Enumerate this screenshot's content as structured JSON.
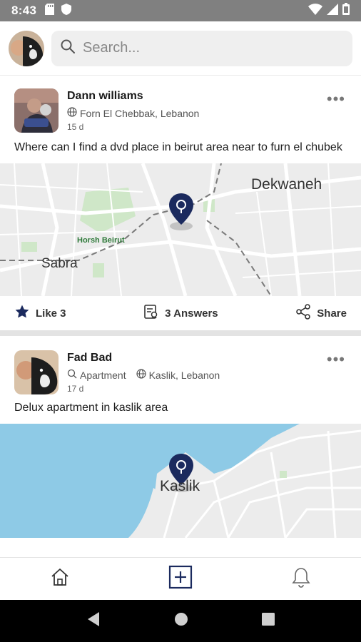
{
  "status_bar": {
    "time": "8:43"
  },
  "search": {
    "placeholder": "Search..."
  },
  "posts": [
    {
      "author": "Dann williams",
      "location": "Forn El Chebbak, Lebanon",
      "age": "15 d",
      "text": "Where can I find a dvd place in beirut area near to furn el chubek",
      "map_labels": {
        "a": "Dekwaneh",
        "b": "Horsh Beirut",
        "c": "Sabra"
      },
      "actions": {
        "like": "Like 3",
        "answers": "3 Answers",
        "share": "Share"
      }
    },
    {
      "author": "Fad Bad",
      "category": "Apartment",
      "location": "Kaslik, Lebanon",
      "age": "17 d",
      "text": "Delux apartment in kaslik area",
      "map_labels": {
        "a": "Kaslik"
      }
    }
  ],
  "colors": {
    "accent": "#1b2a5e",
    "status_bar": "#808080",
    "water": "#8ecae6",
    "map_land": "#e9e9e9",
    "park": "#cfe7c8"
  },
  "icons": {
    "status": [
      "sd-card-icon",
      "shield-icon",
      "wifi-icon",
      "signal-icon",
      "battery-icon"
    ],
    "nav": [
      "home-icon",
      "add-post-icon",
      "bell-icon"
    ],
    "system": [
      "back-icon",
      "home-circle-icon",
      "recents-icon"
    ]
  }
}
